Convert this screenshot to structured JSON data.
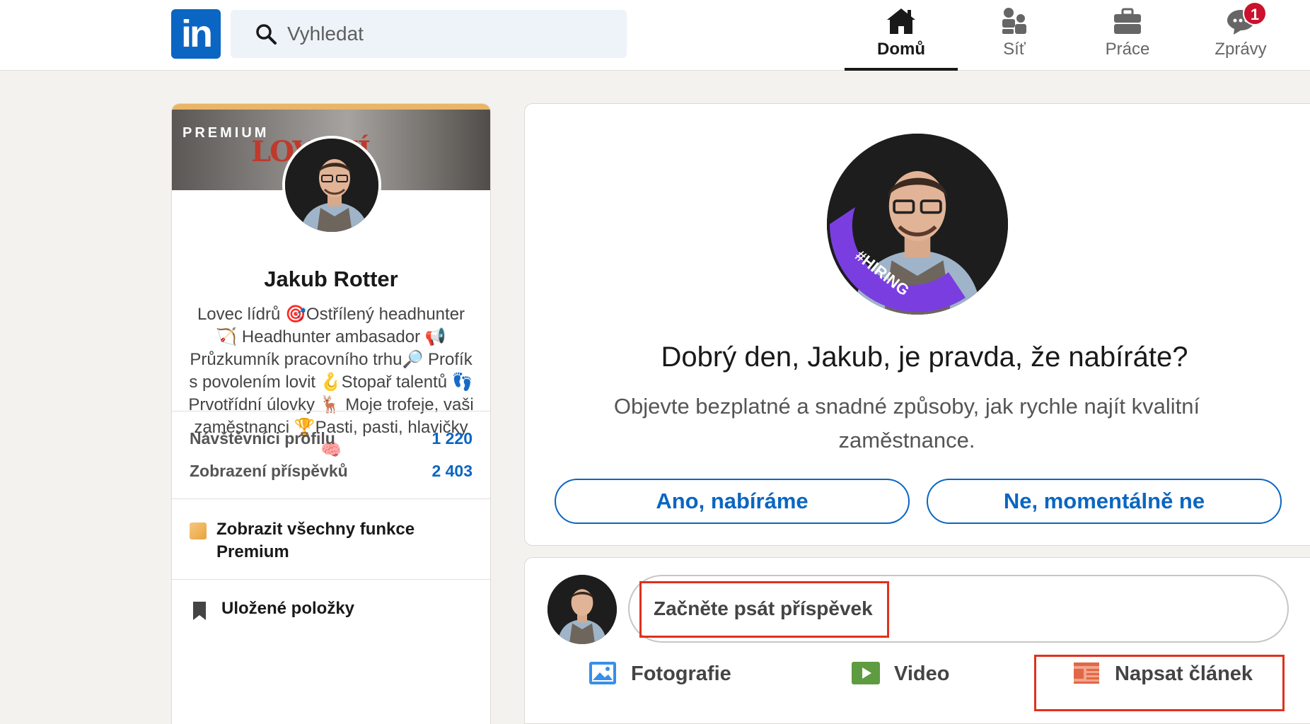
{
  "header": {
    "logo_text": "in",
    "search": {
      "placeholder": "Vyhledat"
    },
    "nav": [
      {
        "label": "Domů",
        "icon": "home-icon",
        "active": true
      },
      {
        "label": "Síť",
        "icon": "network-icon",
        "active": false
      },
      {
        "label": "Práce",
        "icon": "jobs-icon",
        "active": false
      },
      {
        "label": "Zprávy",
        "icon": "messaging-icon",
        "active": false,
        "badge": "1"
      }
    ]
  },
  "profile": {
    "banner_text": "PREMIUM",
    "banner_logo_text": "LOVENÍ",
    "name": "Jakub Rotter",
    "headline": "Lovec lídrů 🎯Ostřílený headhunter 🏹 Headhunter ambasador 📢 Průzkumník pracovního trhu🔎 Profík s povolením lovit 🪝Stopař talentů 👣 Prvotřídní úlovky 🦌 Moje trofeje, vaši zaměstnanci 🏆Pasti, pasti, hlavičky🧠",
    "stats": [
      {
        "label": "Návštěvníci profilu",
        "value": "1 220"
      },
      {
        "label": "Zobrazení příspěvků",
        "value": "2 403"
      }
    ],
    "premium_link": "Zobrazit všechny funkce Premium",
    "saved_items": "Uložené položky"
  },
  "hiring": {
    "badge_text": "#HIRING",
    "title": "Dobrý den, Jakub, je pravda, že nabíráte?",
    "subtitle": "Objevte bezplatné a snadné způsoby, jak rychle najít kvalitní zaměstnance.",
    "yes_button": "Ano, nabíráme",
    "no_button": "Ne, momentálně ne"
  },
  "composer": {
    "placeholder": "Začněte psát příspěvek",
    "actions": [
      {
        "label": "Fotografie",
        "icon": "photo-icon",
        "color": "#378fe9"
      },
      {
        "label": "Video",
        "icon": "video-icon",
        "color": "#5f9b41"
      },
      {
        "label": "Napsat článek",
        "icon": "article-icon",
        "color": "#e06847"
      }
    ]
  },
  "colors": {
    "brand": "#0a66c2",
    "background": "#f4f2ee",
    "highlight": "#e0311d",
    "hiring_purple": "#7a3ee0"
  }
}
